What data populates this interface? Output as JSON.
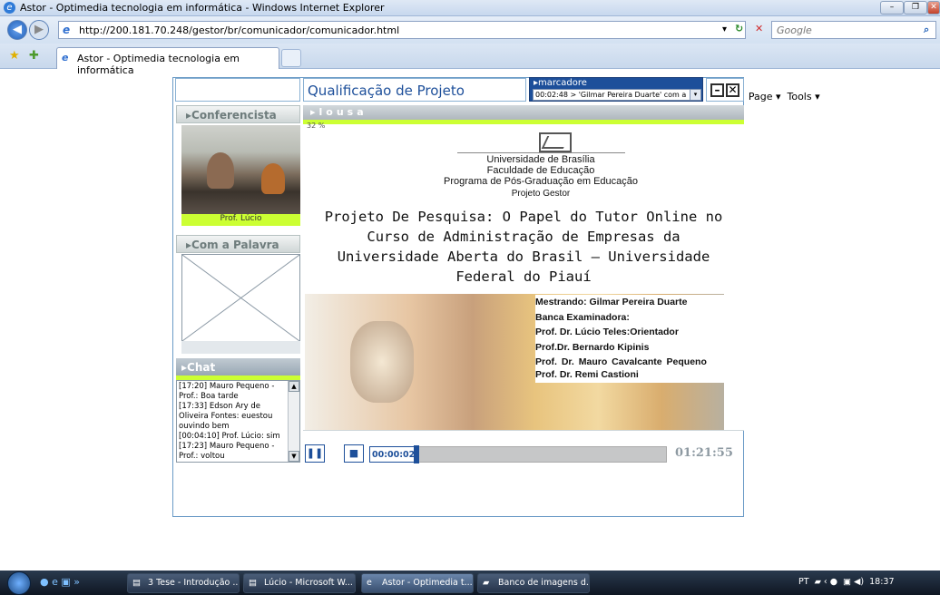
{
  "window": {
    "title": "Astor - Optimedia tecnologia em informática - Windows Internet Explorer",
    "url": "http://200.181.70.248/gestor/br/comunicador/comunicador.html",
    "search_placeholder": "Google",
    "tab_label": "Astor - Optimedia tecnologia em informática",
    "cmd_page": "Page ▾",
    "cmd_tools": "Tools ▾"
  },
  "app": {
    "title": "Qualificação de Projeto",
    "marcadores_label": "▸marcadore",
    "marcador_selected": "00:02:48 > 'Gilmar Pereira Duarte' com a",
    "conferencista_header": "▸Conferencista",
    "conferencista_name": "Prof. Lúcio",
    "com_a_palavra_header": "▸Com a Palavra",
    "chat_header": "▸Chat",
    "lousa_header": "▸lousa",
    "zoom_pct": "32 %"
  },
  "chat": [
    "[17:20] Mauro Pequeno - Prof.: Boa tarde",
    "[17:33] Edson Ary de Oliveira Fontes: euestou ouvindo bem",
    "[00:04:10] Prof. Lúcio: sim",
    "[17:23] Mauro Pequeno - Prof.: voltou"
  ],
  "slide": {
    "inst1": "Universidade de Brasília",
    "inst2": "Faculdade de Educação",
    "inst3": "Programa de Pós-Graduação em Educação",
    "inst4": "Projeto Gestor",
    "main_title": "Projeto De Pesquisa: O Papel do Tutor Online no Curso de Administração de Empresas da Universidade Aberta do Brasil – Universidade Federal do Piauí",
    "credits": [
      "Mestrando: Gilmar Pereira Duarte",
      "Banca Examinadora:",
      "Prof. Dr. Lúcio Teles:Orientador",
      "Prof.Dr. Bernardo Kipinis",
      "Prof.   Dr.   Mauro   Cavalcante Pequeno",
      "Prof. Dr. Remi Castioni"
    ]
  },
  "player": {
    "current_time": "00:00:02",
    "total_time": "01:21:55",
    "progress_fraction": 0.0004
  },
  "taskbar": {
    "items": [
      "3 Tese - Introdução ...",
      "Lúcio - Microsoft W...",
      "Astor - Optimedia t...",
      "Banco de imagens d..."
    ],
    "tray_lang": "PT",
    "clock": "18:37"
  }
}
